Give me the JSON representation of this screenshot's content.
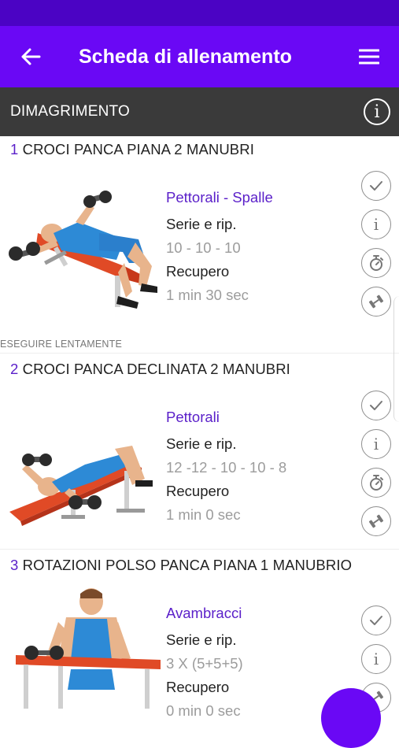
{
  "app_bar": {
    "title": "Scheda di allenamento",
    "back_icon": "arrow-left-icon",
    "menu_icon": "hamburger-menu-icon",
    "background": "#6a08f5",
    "status_background": "#4b03c4"
  },
  "section": {
    "title": "DIMAGRIMENTO",
    "info_label": "i",
    "background": "#3a3a3a"
  },
  "exercises": [
    {
      "number": "1",
      "name": "CROCI PANCA PIANA 2 MANUBRI",
      "muscle": "Pettorali - Spalle",
      "sets_label": "Serie e rip.",
      "sets_value": "10 - 10 - 10",
      "rest_label": "Recupero",
      "rest_value": "1 min 30 sec",
      "note": "ESEGUIRE LENTAMENTE"
    },
    {
      "number": "2",
      "name": "CROCI PANCA DECLINATA 2 MANUBRI",
      "muscle": "Pettorali",
      "sets_label": "Serie e rip.",
      "sets_value": "12 -12 - 10 - 10 - 8",
      "rest_label": "Recupero",
      "rest_value": "1 min 0 sec"
    },
    {
      "number": "3",
      "name": "ROTAZIONI POLSO PANCA PIANA 1 MANUBRIO",
      "muscle": "Avambracci",
      "sets_label": "Serie e rip.",
      "sets_value": "3 X (5+5+5)",
      "rest_label": "Recupero",
      "rest_value": "0 min 0 sec"
    }
  ],
  "action_icons": [
    "check-icon",
    "info-icon",
    "stopwatch-icon",
    "dumbbell-icon"
  ],
  "info_label": "i",
  "accent_color": "#5a1fc9"
}
